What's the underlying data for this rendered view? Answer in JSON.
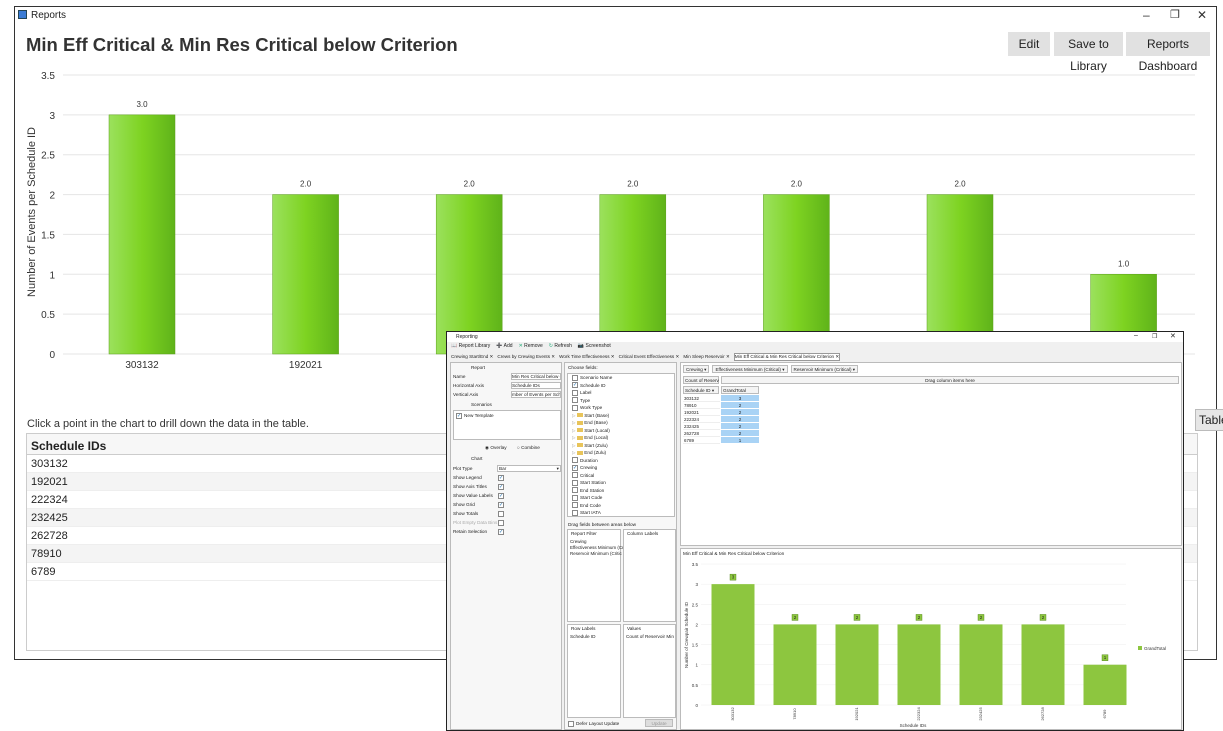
{
  "reports_window": {
    "title": "Reports",
    "heading": "Min Eff Critical & Min Res Critical below Criterion",
    "buttons": {
      "edit": "Edit",
      "save": "Save to Library",
      "dashboard": "Reports Dashboard"
    },
    "hint": "Click a point in the chart to drill down the data in the table.",
    "table_header": "Schedule IDs",
    "table_rows": [
      "303132",
      "192021",
      "222324",
      "232425",
      "262728",
      "78910",
      "6789"
    ],
    "table_button": "Table"
  },
  "chart_data": [
    {
      "type": "bar",
      "categories": [
        "303132",
        "192021",
        "222324",
        "232425",
        "262728",
        "78910",
        "6789"
      ],
      "values": [
        3,
        2,
        2,
        2,
        2,
        2,
        1
      ],
      "value_labels": [
        "3.0",
        "2.0",
        "2.0",
        "2.0",
        "2.0",
        "2.0",
        "1.0"
      ],
      "ylabel": "Number of Events per Schedule ID",
      "ylim": [
        0,
        3.5
      ],
      "yticks": [
        "0",
        "0.5",
        "1",
        "1.5",
        "2",
        "2.5",
        "3",
        "3.5"
      ],
      "color": "#7ed321",
      "grid": true
    },
    {
      "type": "bar",
      "title": "Min Eff Critical & Min Res Critical below Criterion",
      "categories": [
        "303132",
        "78910",
        "192021",
        "222324",
        "232425",
        "262728",
        "6789"
      ],
      "values": [
        3,
        2,
        2,
        2,
        2,
        2,
        1
      ],
      "value_labels": [
        "3",
        "2",
        "2",
        "2",
        "2",
        "2",
        "1"
      ],
      "xlabel": "Schedule IDs",
      "ylabel": "Number of Crewpair Schedule ID",
      "ylim": [
        0,
        3.5
      ],
      "yticks": [
        "0",
        "0.5",
        "1",
        "1.5",
        "2",
        "2.5",
        "3",
        "3.5"
      ],
      "legend": "GrandTotal",
      "color": "#8dc63f"
    }
  ],
  "reporting_window": {
    "title": "Reporting",
    "toolbar": [
      "Report Library",
      "Add",
      "Remove",
      "Refresh",
      "Screenshot"
    ],
    "tabs": [
      "Crewing Start/End",
      "Crews by Crewing Events",
      "Work Time Effectiveness",
      "Critical Event Effectiveness",
      "Min Sleep Reservoir",
      "Min Eff Critical & Min Res Critical below Criterion"
    ],
    "report_section": "Report",
    "name_label": "Name",
    "name_value": "Min Res Critical below Criterion",
    "haxis_label": "Horizontal Axis",
    "haxis_value": "Schedule IDs",
    "vaxis_label": "Vertical Axis",
    "vaxis_value": "mber of Events per Schedule ID",
    "scenarios_label": "Scenarios",
    "scenario_item": "New Template",
    "overlay": "Overlay",
    "combine": "Combine",
    "chart_section": "Chart",
    "plot_type_label": "Plot Type",
    "plot_type_value": "Bar",
    "options": [
      "Show Legend",
      "Show Axis Titles",
      "Show Value Labels",
      "Show Grid",
      "Show Totals",
      "Plot Empty Data Bins",
      "Retain Selection"
    ],
    "choose_fields": "Choose fields:",
    "fields": [
      "Scenario Name",
      "Schedule ID",
      "Label",
      "Type",
      "Work Type",
      "Start (Base)",
      "End (Base)",
      "Start (Local)",
      "End (Local)",
      "Start (Zulu)",
      "End (Zulu)",
      "Duration",
      "Crewing",
      "Critical",
      "Start Station",
      "End Station",
      "Start Code",
      "End Code",
      "Start IATA"
    ],
    "drag_hint": "Drag fields between areas below",
    "report_filter": "Report Filter",
    "filter_items": [
      "Crewing",
      "Effectiveness Minimum (Cr",
      "Reservoir Minimum (Critic"
    ],
    "column_labels": "Column Labels",
    "row_labels": "Row Labels",
    "row_item": "Schedule ID",
    "values_label": "Values",
    "values_item": "Count of Reservoir Min",
    "defer": "Defer Layout Update",
    "update": "Update",
    "pivot_filters": [
      "Crewing",
      "Effectiveness Minimum (Critical)",
      "Reservoir Minimum (Critical)"
    ],
    "pivot_count": "Count of Reserv",
    "pivot_drag": "Drag column items here",
    "pivot_col_header": "Schedule ID",
    "pivot_total_header": "GrandTotal",
    "pivot_rows": [
      [
        "303132",
        "3"
      ],
      [
        "78910",
        "2"
      ],
      [
        "192021",
        "2"
      ],
      [
        "222324",
        "2"
      ],
      [
        "232425",
        "2"
      ],
      [
        "262728",
        "2"
      ],
      [
        "6789",
        "1"
      ]
    ]
  }
}
